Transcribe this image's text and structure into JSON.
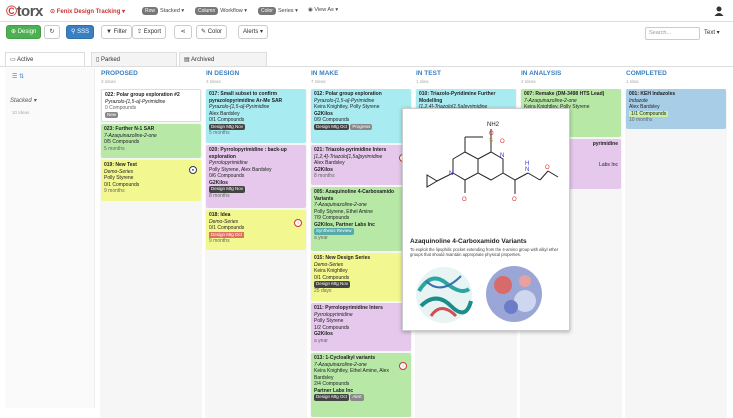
{
  "app": {
    "logo": "torx",
    "project": "Fenix Design Tracking",
    "row_label": "Row",
    "row_value": "Stacked",
    "column_label": "Column",
    "column_value": "Workflow",
    "color_label": "Color",
    "color_value": "Series",
    "view_as": "View As"
  },
  "toolbar": {
    "design": "Design",
    "sss": "SSS",
    "filter": "Filter",
    "export": "Export",
    "color": "Color",
    "alerts": "Alerts",
    "search_placeholder": "Search...",
    "text_select": "Text"
  },
  "tabs": [
    {
      "label": "Active"
    },
    {
      "label": "Parked"
    },
    {
      "label": "Archived"
    }
  ],
  "side": {
    "label": "Stacked",
    "sub": "10 Ideas"
  },
  "columns": [
    {
      "title": "PROPOSED",
      "sub": "3 Ideas"
    },
    {
      "title": "IN DESIGN",
      "sub": "3 Ideas"
    },
    {
      "title": "IN MAKE",
      "sub": "7 Ideas"
    },
    {
      "title": "IN TEST",
      "sub": "1 Idea"
    },
    {
      "title": "IN ANALYSIS",
      "sub": "2 Ideas"
    },
    {
      "title": "COMPLETED",
      "sub": "1 Idea"
    }
  ],
  "cards": {
    "c1": {
      "title": "022: Polar group exploration #2",
      "series": "Pyrazolo-[1,5-a]-Pyrimidine",
      "compounds": "0 Compounds",
      "tag": "New"
    },
    "c2": {
      "title": "023: Further N-1 SAR",
      "series": "7-Azaquinazoline-2-one",
      "compounds": "0/5 Compounds",
      "time": "5 months"
    },
    "c3": {
      "title": "019: New Test",
      "series": "Demo-Series",
      "person": "Polly Styrene",
      "compounds": "0/1 Compounds",
      "time": "9 months"
    },
    "d1": {
      "title": "017: Small subset to confirm pyrazolopyrimidine Ar-Me SAR",
      "series": "Pyrazolo-[1,5-a]-Pyrimidine",
      "person": "Alex Bardsley",
      "compounds": "0/1 Compounds",
      "tag": "Design Mtg Nov",
      "time": "5 months"
    },
    "d2": {
      "title": "020: Pyrrolopyrimidine : back-up exploration",
      "series": "Pyrrolopyrimidine",
      "person": "Polly Styrene, Alex Bardsley",
      "compounds": "0/6 Compounds",
      "vendor": "G2Kilos",
      "tag": "Design Mtg Nov",
      "time": "8 months"
    },
    "d3": {
      "title": "018: Idea",
      "series": "Demo-Series",
      "compounds": "0/1 Compounds",
      "tag": "Design Mtg Oct",
      "time": "9 months"
    },
    "m1": {
      "title": "012: Polar group exploration",
      "series": "Pyrazolo-[1,5-a]-Pyrimidine",
      "person": "Keira Knightley, Polly Styrene",
      "vendor": "G2Kilos",
      "compounds": "0/9 Compounds",
      "tag": "Design Mtg Oct",
      "status": "Progress"
    },
    "m2": {
      "title": "021: Triazolo-pyrimidine Inters",
      "series": "[1,2,4]-Triazolo[1,5a]pyrimidine",
      "person": "Alex Bardsley",
      "vendor": "G2Kilos",
      "time": "8 months"
    },
    "m3": {
      "title": "005: Azaquinoline 4-Carboxamido Variants",
      "series": "7-Azaquinazoline-2-one",
      "person": "Polly Styrene, Ethel Amine",
      "compounds": "7/9 Compounds",
      "vendor": "G2Kilos, Partner Labs Inc",
      "tag": "Synthesis Review",
      "time": "a year"
    },
    "m4": {
      "title": "015: New Design Series",
      "series": "Demo-Series",
      "person": "Keira Knightley",
      "compounds": "0/1 Compounds",
      "tag": "Design Mtg Nov",
      "time": "25 days"
    },
    "m5": {
      "title": "011: Pyrrolopyrimidine Inters",
      "series": "Pyrrolopyrimidine",
      "person": "Polly Styrene",
      "compounds": "1/2 Compounds",
      "vendor": "G2Kilos",
      "time": "a year"
    },
    "m6": {
      "title": "013: 1-Cycloalkyl variants",
      "series": "7-Azaquinazoline-2-one",
      "person": "Keira Knightley, Ethel Amine, Alex Bardsley",
      "compounds": "2/4 Compounds",
      "vendor": "Partner Labs Inc",
      "tag": "Design Mtg Oct",
      "status": "Alert"
    },
    "t1": {
      "title": "010: Triazolo-Pyridimine Further Modelling",
      "series": "[1,2,4]-Triazolo[1,5a]pyrimidine"
    },
    "a1": {
      "title": "007: Remake (DM-3498 HTS Lead)",
      "series": "7-Azaquinazoline-2-one",
      "person": "Keira Knightley, Polly Styrene",
      "vendor": "Partner Labs Inc"
    },
    "a2": {
      "title": "pyrimidine",
      "series": "Labs Inc"
    },
    "k1": {
      "title": "001: KEH Indazoles",
      "series": "Indazole",
      "person": "Alex Bardsley",
      "compounds": "1/1 Compounds",
      "time": "10 months"
    }
  },
  "popup": {
    "title": "Azaquinoline 4-Carboxamido Variants",
    "desc": "To exploit the lipophilic pocket extending from the 4-amino group with alkyl ether groups that should maintain appropriate physical properties.",
    "atoms": {
      "nh2": "NH2",
      "s": "S",
      "o1": "O",
      "o2": "O",
      "n1": "N",
      "n2": "N",
      "o3": "O",
      "nh": "N",
      "h": "H",
      "o4": "O"
    }
  },
  "colors": {
    "accent": "#3a7fc1",
    "brand": "#cc3333",
    "design_button": "#4caf50"
  }
}
